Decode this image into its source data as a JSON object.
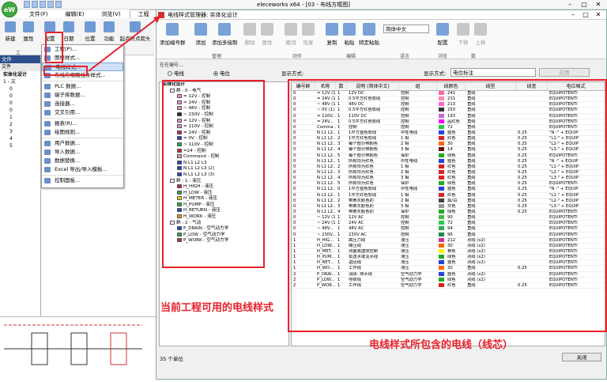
{
  "app": {
    "title": "eleceworks x64 - [03 - 布线方框图]",
    "logo": "eW",
    "tabs": [
      "文件(F)",
      "编辑(E)",
      "浏览(V)",
      "工程",
      "处理"
    ],
    "active_tab": "工程"
  },
  "ribbon": {
    "buttons": [
      "新建",
      "属性",
      "配置",
      "日期",
      "位置",
      "功能",
      "起点终点箭头"
    ],
    "group_label": "工"
  },
  "left_panel": {
    "header": "文件",
    "tab": "文件",
    "tree": [
      "实体化设计",
      "1 - 文",
      "0",
      "0",
      "0",
      "0",
      "1",
      "2",
      "3",
      "4",
      "5"
    ]
  },
  "config_menu": {
    "items": [
      "工程(P)...",
      "图框样式...",
      "电线样式...",
      "布线方框图线条样式...",
      "PLC 数据...",
      "端子排数据...",
      "连接器...",
      "交叉引用...",
      "报表(R)...",
      "绘图规则...",
      "用户数据...",
      "导入数据...",
      "数据替换...",
      "Excel 导出/导入模板...",
      "控制面板..."
    ],
    "highlighted": "电线样式..."
  },
  "dialog": {
    "title": "电线样式管理器: 实体化设计",
    "tools": {
      "add_wire": "添加编号群",
      "add": "添加",
      "add_multi": "添加多接制",
      "delete": "删除",
      "props": "属性",
      "undo": "撤消",
      "redo": "恢复",
      "copy": "复制",
      "paste": "粘贴",
      "special_paste": "特定粘贴",
      "language": "简体中文",
      "configure": "配置",
      "down": "下移",
      "up": "上移"
    },
    "groups": [
      "管理",
      "动作",
      "编辑",
      "语言",
      "浏览",
      "数"
    ],
    "filter": {
      "label": "在在编号...",
      "wire_radio": "电线",
      "potential_radio": "电位",
      "display_mode_label": "显示方式:",
      "display_type_label": "显示方式:",
      "display_type_value": "电位标注",
      "apply": "应用"
    },
    "tree": {
      "root": "实体化设计",
      "items": [
        {
          "label": "群 : 0 - 电气",
          "color": "#ffffff",
          "level": 1
        },
        {
          "label": "= 12V - 控制",
          "color": "#ff88cc",
          "level": 2
        },
        {
          "label": "= 24V - 控制",
          "color": "#ff88cc",
          "level": 2
        },
        {
          "label": "~ 48V - 控制",
          "color": "#ff88cc",
          "level": 2
        },
        {
          "label": "~ 230V - 控制",
          "color": "#222222",
          "level": 2
        },
        {
          "label": "= 12V - 控制",
          "color": "#ff88cc",
          "level": 2
        },
        {
          "label": "= 110V - 控制",
          "color": "#ff88cc",
          "level": 2
        },
        {
          "label": "= 24V - 控制",
          "color": "#cc2244",
          "level": 2
        },
        {
          "label": "= 0V - 控制",
          "color": "#2244cc",
          "level": 2
        },
        {
          "label": "~ 110V - 控制",
          "color": "#22aa44",
          "level": 2
        },
        {
          "label": "=24 - 控制",
          "color": "#cc2244",
          "level": 2
        },
        {
          "label": "Command - 控制",
          "color": "#ff88cc",
          "level": 2
        },
        {
          "label": "N L1 L2 L3",
          "color": "#2244cc",
          "level": 2
        },
        {
          "label": "N L1 L2 L3 (2)",
          "color": "#2244cc",
          "level": 2
        },
        {
          "label": "N L1 L2 L3 (3)",
          "color": "#2244cc",
          "level": 2
        },
        {
          "label": "群 : 1 - 液压",
          "color": "#ffffff",
          "level": 1
        },
        {
          "label": "H_HIGH - 液压",
          "color": "#cc2244",
          "level": 2
        },
        {
          "label": "H_LOW - 液压",
          "color": "#22aa44",
          "level": 2
        },
        {
          "label": "H_METER - 液压",
          "color": "#ffcc00",
          "level": 2
        },
        {
          "label": "H_PUMP - 液压",
          "color": "#22aa44",
          "level": 2
        },
        {
          "label": "H_RETURN - 液压",
          "color": "#2244cc",
          "level": 2
        },
        {
          "label": "H_WORK - 液压",
          "color": "#ff8800",
          "level": 2
        },
        {
          "label": "群 : 2 - 气动",
          "color": "#ffffff",
          "level": 1
        },
        {
          "label": "P_DRAIN - 空气动力学",
          "color": "#2244cc",
          "level": 2
        },
        {
          "label": "P_LOW - 空气动力学",
          "color": "#22aa44",
          "level": 2
        },
        {
          "label": "P_WORK - 空气动力学",
          "color": "#cc2244",
          "level": 2
        }
      ]
    },
    "grid": {
      "headers": [
        "编号群",
        "名称",
        "数",
        "说明 (简体中文)",
        "组",
        "线颜色",
        "线型",
        "线宽",
        "电位格式"
      ],
      "rows": [
        [
          "0",
          "= 12V (1)",
          "1",
          "12V DC",
          "控制",
          "241",
          "#ff66aa",
          "直线",
          "",
          "EQUIPOTENTI"
        ],
        [
          "0",
          "= 24V (1)",
          "1",
          "0.5平方红色软线",
          "控制",
          "231",
          "#ff88bb",
          "直线",
          "",
          "EQUIPOTENTI"
        ],
        [
          "0",
          "~ 48V (1)",
          "1",
          "48V DC",
          "控制",
          "213",
          "#ff66cc",
          "直线",
          "",
          "EQUIPOTENTI"
        ],
        [
          "0",
          "~ 0V (1)",
          "1",
          "0.5平方红色软线",
          "控制",
          "250",
          "#333333",
          "直线",
          "",
          "EQUIPOTENTI"
        ],
        [
          "0",
          "= 110V...",
          "1",
          "110V DC",
          "控制",
          "193",
          "#cc66cc",
          "直线",
          "",
          "EQUIPOTENTI"
        ],
        [
          "0",
          "= 24V...",
          "1",
          "0.5平方红色软线",
          "控制",
          "品红色",
          "#ff00ff",
          "直线",
          "",
          "EQUIPOTENTI"
        ],
        [
          "0",
          "Comma...",
          "1",
          "控制",
          "控制",
          "72",
          "#22cc44",
          "直线",
          "",
          "EQUIPOTENTI"
        ],
        [
          "0",
          "N L1 L2...",
          "1",
          "1平方蓝色软线",
          "中性电线",
          "蓝色",
          "#2244dd",
          "直线",
          "0.25",
          "\"N -\" + EQUIP"
        ],
        [
          "0",
          "N L1 L2...",
          "2",
          "1平方红色软线",
          "1 相",
          "红色",
          "#dd2222",
          "直线",
          "0.25",
          "\"L1-\" + EQUIP"
        ],
        [
          "0",
          "N L1 L2...",
          "3",
          "每个部分带颜色",
          "2 相",
          "30",
          "#ff6600",
          "直线",
          "0.25",
          "\"L2-\" + EQUIP"
        ],
        [
          "0",
          "N L1 L2...",
          "4",
          "每个部分带颜色",
          "3 相",
          "14",
          "#661111",
          "直线",
          "0.25",
          "\"L3-\" + EQUIP"
        ],
        [
          "0",
          "N L1 L2...",
          "5",
          "每个部分带颜色",
          "保护",
          "绿色",
          "#22aa22",
          "直线",
          "0.25",
          "EQUIPOTENTI"
        ],
        [
          "0",
          "N L1 L2...",
          "1",
          "所有项为红色",
          "中性电线",
          "蓝色",
          "#2244dd",
          "直线",
          "0.25",
          "\"N -\" + EQUIP"
        ],
        [
          "0",
          "N L1 L2...",
          "2",
          "所有项为红色",
          "1 相",
          "红色",
          "#dd2222",
          "直线",
          "0.25",
          "\"L1-\" + EQUIP"
        ],
        [
          "0",
          "N L1 L2...",
          "3",
          "所有项为红色",
          "2 相",
          "红色",
          "#dd2222",
          "直线",
          "0.25",
          "\"L2-\" + EQUIP"
        ],
        [
          "0",
          "N L1 L2...",
          "4",
          "所有项为红色",
          "3 相",
          "红色",
          "#dd2222",
          "直线",
          "0.25",
          "\"L3-\" + EQUIP"
        ],
        [
          "0",
          "N L1 L2...",
          "5",
          "所有项为红色",
          "保护",
          "绿色",
          "#22aa22",
          "直线",
          "0.25",
          "EQUIPOTENTI"
        ],
        [
          "0",
          "N L1 L2...",
          "0",
          "1平方蓝色软线",
          "中性电线",
          "蓝色",
          "#2244dd",
          "直线",
          "0.25",
          "\"N -\" + EQUIP"
        ],
        [
          "0",
          "N L1 L2...",
          "1",
          "1平方红色软线",
          "1 相",
          "红色",
          "#dd2222",
          "直线",
          "0.25",
          "\"L1-\" + EQUIP"
        ],
        [
          "0",
          "N L1 L2...",
          "2",
          "带黄灰颜色的",
          "2 相",
          "黑/白",
          "#444444",
          "直线",
          "0.25",
          "\"L2-\" + EQUIP"
        ],
        [
          "0",
          "N L1 L2...",
          "3",
          "带黄灰颜色的",
          "3 相",
          "灰色",
          "#999999",
          "直线",
          "0.25",
          "\"L3-\" + EQUIP"
        ],
        [
          "0",
          "N L1 L2...",
          "4",
          "带黄灰颜色的",
          "保护",
          "绿色",
          "#22aa22",
          "直线",
          "0.25",
          "EQUIPOTENTI"
        ],
        [
          "0",
          "~ 12V (1)",
          "1",
          "12V AC",
          "控制",
          "90",
          "#44bb44",
          "直线",
          "",
          "EQUIPOTENTI"
        ],
        [
          "0",
          "~ 24V (1)",
          "1",
          "24V AC",
          "控制",
          "72",
          "#22cc44",
          "直线",
          "",
          "EQUIPOTENTI"
        ],
        [
          "0",
          "~ 48V...",
          "1",
          "48V AC",
          "控制",
          "94",
          "#33aa55",
          "直线",
          "",
          "EQUIPOTENTI"
        ],
        [
          "0",
          "~ 230V...",
          "1",
          "230V AC",
          "控制",
          "96",
          "#228844",
          "直线",
          "",
          "EQUIPOTENTI"
        ],
        [
          "1",
          "H_HIG...",
          "1",
          "高压力线",
          "液压",
          "212",
          "#cc3399",
          "点线 (x2)",
          "",
          "EQUIPOTENTI"
        ],
        [
          "1",
          "H_LOW...",
          "1",
          "降压线",
          "液压",
          "30",
          "#ff6600",
          "点线 (x2)",
          "",
          "EQUIPOTENTI"
        ],
        [
          "1",
          "H_MET...",
          "1",
          "测量或虚限控制",
          "液压",
          "黄色",
          "#ffee00",
          "点线 (x2)",
          "",
          "EQUIPOTENTI"
        ],
        [
          "1",
          "H_PUM...",
          "1",
          "泵送水或泥水线",
          "液压",
          "绿色",
          "#22aa22",
          "点线 (x2)",
          "",
          "EQUIPOTENTI"
        ],
        [
          "1",
          "H_RET...",
          "1",
          "返回线",
          "液压",
          "蓝色",
          "#2244dd",
          "点线 (x2)",
          "",
          "EQUIPOTENTI"
        ],
        [
          "1",
          "H_WO...",
          "1",
          "工作线",
          "液压",
          "30",
          "#ff6600",
          "直线",
          "0.25",
          "EQUIPOTENTI"
        ],
        [
          "2",
          "P_DRAI...",
          "1",
          "清除: 排水线",
          "空气动力学",
          "蓝色",
          "#2244dd",
          "点线 (x2)",
          "",
          "EQUIPOTENTI"
        ],
        [
          "2",
          "P_LOW...",
          "1",
          "导航线",
          "空气动力学",
          "绿色",
          "#22aa22",
          "点线 (x2)",
          "",
          "EQUIPOTENTI"
        ],
        [
          "2",
          "P_WOR...",
          "1",
          "工作线",
          "空气动力学",
          "红色",
          "#dd2222",
          "直线",
          "0.25",
          "EQUIPOTENTI"
        ]
      ]
    },
    "status": "35 个单位",
    "close": "关闭"
  },
  "annotations": {
    "left": "当前工程可用的电线样式",
    "right": "电线样式所包含的电线（线芯）",
    "color": "#e8212b"
  }
}
